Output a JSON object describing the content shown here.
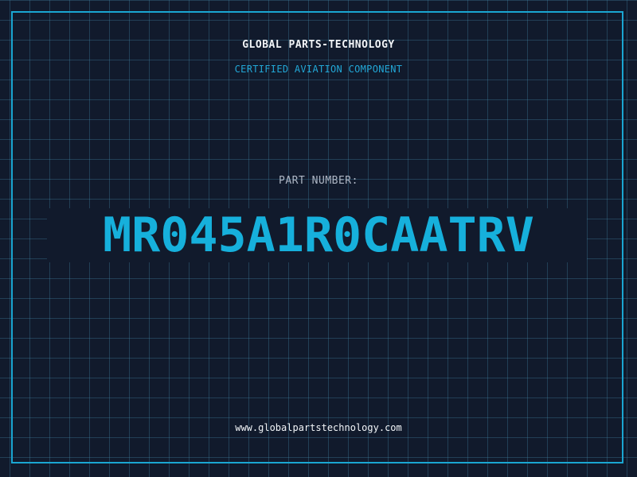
{
  "header": {
    "company": "GLOBAL PARTS-TECHNOLOGY",
    "subtitle": "CERTIFIED AVIATION COMPONENT"
  },
  "part": {
    "label": "PART NUMBER:",
    "number": "MR045A1R0CAATRV"
  },
  "footer": {
    "url": "www.globalpartstechnology.com"
  },
  "colors": {
    "background": "#111a2c",
    "grid": "#468caf",
    "accent": "#16b0dc",
    "heading": "#f2f5f8",
    "label": "#aeb6c4"
  }
}
